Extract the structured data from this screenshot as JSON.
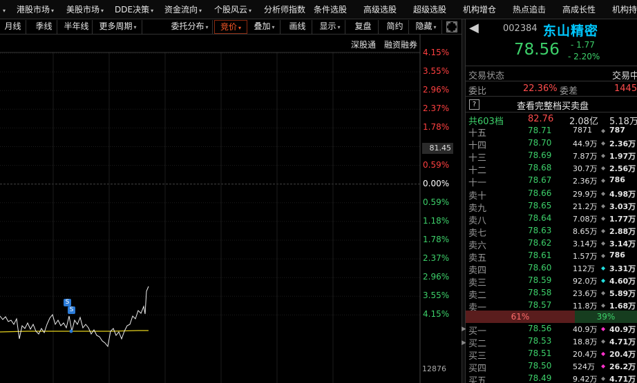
{
  "menu": [
    {
      "label": "港股市场",
      "caret": true
    },
    {
      "label": "美股市场",
      "caret": true
    },
    {
      "label": "DDE决策",
      "caret": true
    },
    {
      "label": "资金流向",
      "caret": true
    },
    {
      "label": "个股风云",
      "caret": true
    },
    {
      "label": "分析师指数",
      "caret": false
    },
    {
      "label": "条件选股",
      "caret": false
    },
    {
      "label": "高级选股",
      "caret": false
    },
    {
      "label": "超级选股",
      "caret": false
    },
    {
      "label": "机构增仓",
      "caret": false
    },
    {
      "label": "热点追击",
      "caret": false
    },
    {
      "label": "高成长性",
      "caret": false
    },
    {
      "label": "机构持",
      "caret": false
    }
  ],
  "toolbar": {
    "period_buttons": [
      "月线",
      "季线",
      "半年线",
      "更多周期"
    ],
    "tool_buttons": [
      "委托分布",
      "竞价",
      "叠加",
      "画线",
      "显示",
      "复盘",
      "简约",
      "隐藏"
    ]
  },
  "chart": {
    "links": [
      "深股通",
      "融资融券"
    ],
    "scale_labels": [
      {
        "text": "4.15%",
        "color": "#ff4040"
      },
      {
        "text": "3.55%",
        "color": "#ff4040"
      },
      {
        "text": "2.96%",
        "color": "#ff4040"
      },
      {
        "text": "2.37%",
        "color": "#ff4040"
      },
      {
        "text": "1.78%",
        "color": "#ff4040"
      },
      {
        "text": "1.18%",
        "color": "#ff4040"
      },
      {
        "text": "0.59%",
        "color": "#ff4040"
      },
      {
        "text": "0.00%",
        "color": "#ffffff"
      },
      {
        "text": "0.59%",
        "color": "#3dd16a"
      },
      {
        "text": "1.18%",
        "color": "#3dd16a"
      },
      {
        "text": "1.78%",
        "color": "#3dd16a"
      },
      {
        "text": "2.37%",
        "color": "#3dd16a"
      },
      {
        "text": "2.96%",
        "color": "#3dd16a"
      },
      {
        "text": "3.55%",
        "color": "#3dd16a"
      },
      {
        "text": "4.15%",
        "color": "#3dd16a"
      }
    ],
    "price_tag": "81.45",
    "volume_tag": "12876",
    "marker_label": "S"
  },
  "panel": {
    "code": "002384",
    "name": "东山精密",
    "last_price": "78.56",
    "change": "- 1.77",
    "change_pct": "- 2.20%",
    "status_label": "交易状态",
    "status_label_right": "交易中",
    "ratio_label": "委比",
    "ratio_value": "22.36%",
    "diff_label": "委差",
    "diff_value": "1445",
    "help_icon": "?",
    "full_book_label": "查看完整档买卖盘",
    "total_label": "共603档",
    "total_price": "82.76",
    "total_amount": "2.08亿",
    "total_right": "5.18万",
    "asks": [
      {
        "level": "十五",
        "price": "78.71",
        "vol": "7871",
        "amt": "787",
        "dot": "#888888"
      },
      {
        "level": "十四",
        "price": "78.70",
        "vol": "44.9万",
        "amt": "2.36万",
        "dot": "#888888"
      },
      {
        "level": "十三",
        "price": "78.69",
        "vol": "7.87万",
        "amt": "1.97万",
        "dot": "#888888"
      },
      {
        "level": "十二",
        "price": "78.68",
        "vol": "30.7万",
        "amt": "2.56万",
        "dot": "#888888"
      },
      {
        "level": "十一",
        "price": "78.67",
        "vol": "2.36万",
        "amt": "786",
        "dot": "#888888"
      },
      {
        "level": "卖十",
        "price": "78.66",
        "vol": "29.9万",
        "amt": "4.98万",
        "dot": "#888888"
      },
      {
        "level": "卖九",
        "price": "78.65",
        "vol": "21.2万",
        "amt": "3.03万",
        "dot": "#888888"
      },
      {
        "level": "卖八",
        "price": "78.64",
        "vol": "7.08万",
        "amt": "1.77万",
        "dot": "#888888"
      },
      {
        "level": "卖七",
        "price": "78.63",
        "vol": "8.65万",
        "amt": "2.88万",
        "dot": "#888888"
      },
      {
        "level": "卖六",
        "price": "78.62",
        "vol": "3.14万",
        "amt": "3.14万",
        "dot": "#888888"
      },
      {
        "level": "卖五",
        "price": "78.61",
        "vol": "1.57万",
        "amt": "786",
        "dot": "#888888"
      },
      {
        "level": "卖四",
        "price": "78.60",
        "vol": "112万",
        "amt": "3.31万",
        "dot": "#22e0e0"
      },
      {
        "level": "卖三",
        "price": "78.59",
        "vol": "92.0万",
        "amt": "4.60万",
        "dot": "#22e0e0"
      },
      {
        "level": "卖二",
        "price": "78.58",
        "vol": "23.6万",
        "amt": "5.89万",
        "dot": "#888888"
      },
      {
        "level": "卖一",
        "price": "78.57",
        "vol": "11.8万",
        "amt": "1.68万",
        "dot": "#888888"
      }
    ],
    "sell_pct": "61%",
    "buy_pct": "39%",
    "bids": [
      {
        "level": "买一",
        "price": "78.56",
        "vol": "40.9万",
        "amt": "40.9万",
        "dot": "#ff33cc"
      },
      {
        "level": "买二",
        "price": "78.53",
        "vol": "18.8万",
        "amt": "4.71万",
        "dot": "#888888"
      },
      {
        "level": "买三",
        "price": "78.51",
        "vol": "20.4万",
        "amt": "20.4万",
        "dot": "#ff33cc"
      },
      {
        "level": "买四",
        "price": "78.50",
        "vol": "524万",
        "amt": "26.2万",
        "dot": "#ff33cc"
      },
      {
        "level": "买五",
        "price": "78.49",
        "vol": "9.42万",
        "amt": "4.71万",
        "dot": "#888888"
      }
    ]
  }
}
